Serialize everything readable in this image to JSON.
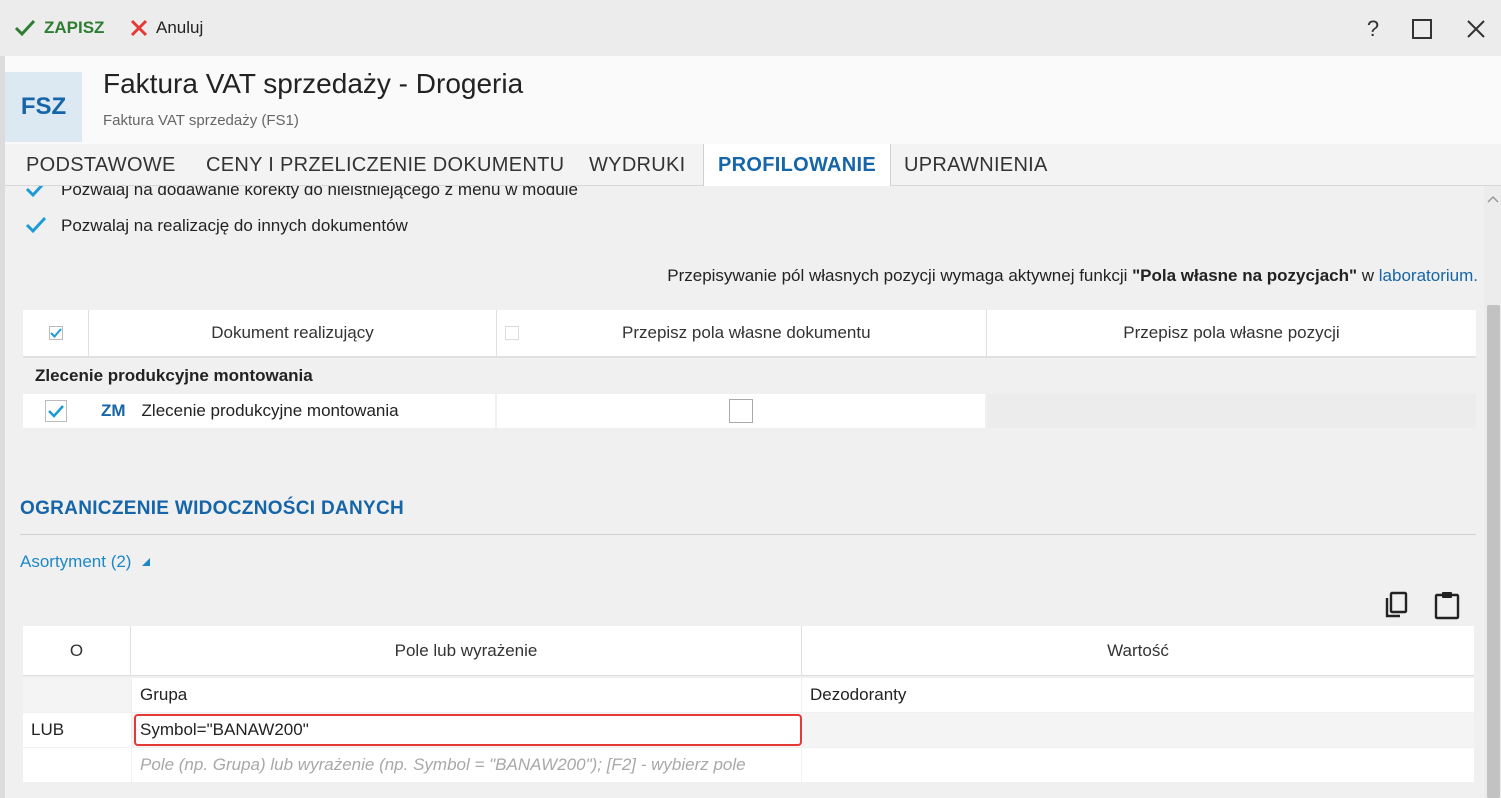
{
  "toolbar": {
    "save_label": "ZAPISZ",
    "cancel_label": "Anuluj",
    "help_label": "?"
  },
  "header": {
    "badge": "FSZ",
    "title": "Faktura VAT sprzedaży - Drogeria",
    "subtitle": "Faktura VAT sprzedaży (FS1)"
  },
  "tabs": [
    {
      "label": "PODSTAWOWE",
      "active": false
    },
    {
      "label": "CENY I PRZELICZENIE DOKUMENTU",
      "active": false
    },
    {
      "label": "WYDRUKI",
      "active": false
    },
    {
      "label": "PROFILOWANIE",
      "active": true
    },
    {
      "label": "UPRAWNIENIA",
      "active": false
    }
  ],
  "options": [
    {
      "label": "Pozwalaj na dodawanie korekty do nieistniejącego z menu w module",
      "checked": true
    },
    {
      "label": "Pozwalaj na realizację do innych dokumentów",
      "checked": true
    }
  ],
  "info": {
    "prefix": "Przepisywanie pól własnych pozycji wymaga aktywnej funkcji ",
    "bold": "\"Pola własne na pozycjach\"",
    "middle": " w ",
    "link": "laboratorium."
  },
  "realization_table": {
    "headers": [
      "Dokument realizujący",
      "Przepisz pola własne dokumentu",
      "Przepisz pola własne pozycji"
    ],
    "group": "Zlecenie produkcyjne montowania",
    "rows": [
      {
        "checked": true,
        "code": "ZM",
        "name": "Zlecenie produkcyjne montowania",
        "copy_doc_fields": false,
        "copy_pos_fields": ""
      }
    ]
  },
  "visibility": {
    "section_title": "OGRANICZENIE WIDOCZNOŚCI DANYCH",
    "assortment_label": "Asortyment (2)",
    "copy_icon": "copy-icon",
    "paste_icon": "paste-icon"
  },
  "filter_grid": {
    "headers": [
      "O",
      "Pole lub wyrażenie",
      "Wartość"
    ],
    "rows": [
      {
        "op": "",
        "field": "Grupa",
        "value": "Dezodoranty"
      },
      {
        "op": "LUB",
        "field": "Symbol=\"BANAW200\"",
        "value": ""
      }
    ],
    "placeholder": "Pole (np. Grupa) lub wyrażenie (np. Symbol = \"BANAW200\"); [F2] - wybierz pole"
  },
  "colors": {
    "accent": "#1565a8",
    "save_green": "#2e7d32",
    "cancel_red": "#e53935",
    "check_blue": "#1e9bd7"
  }
}
